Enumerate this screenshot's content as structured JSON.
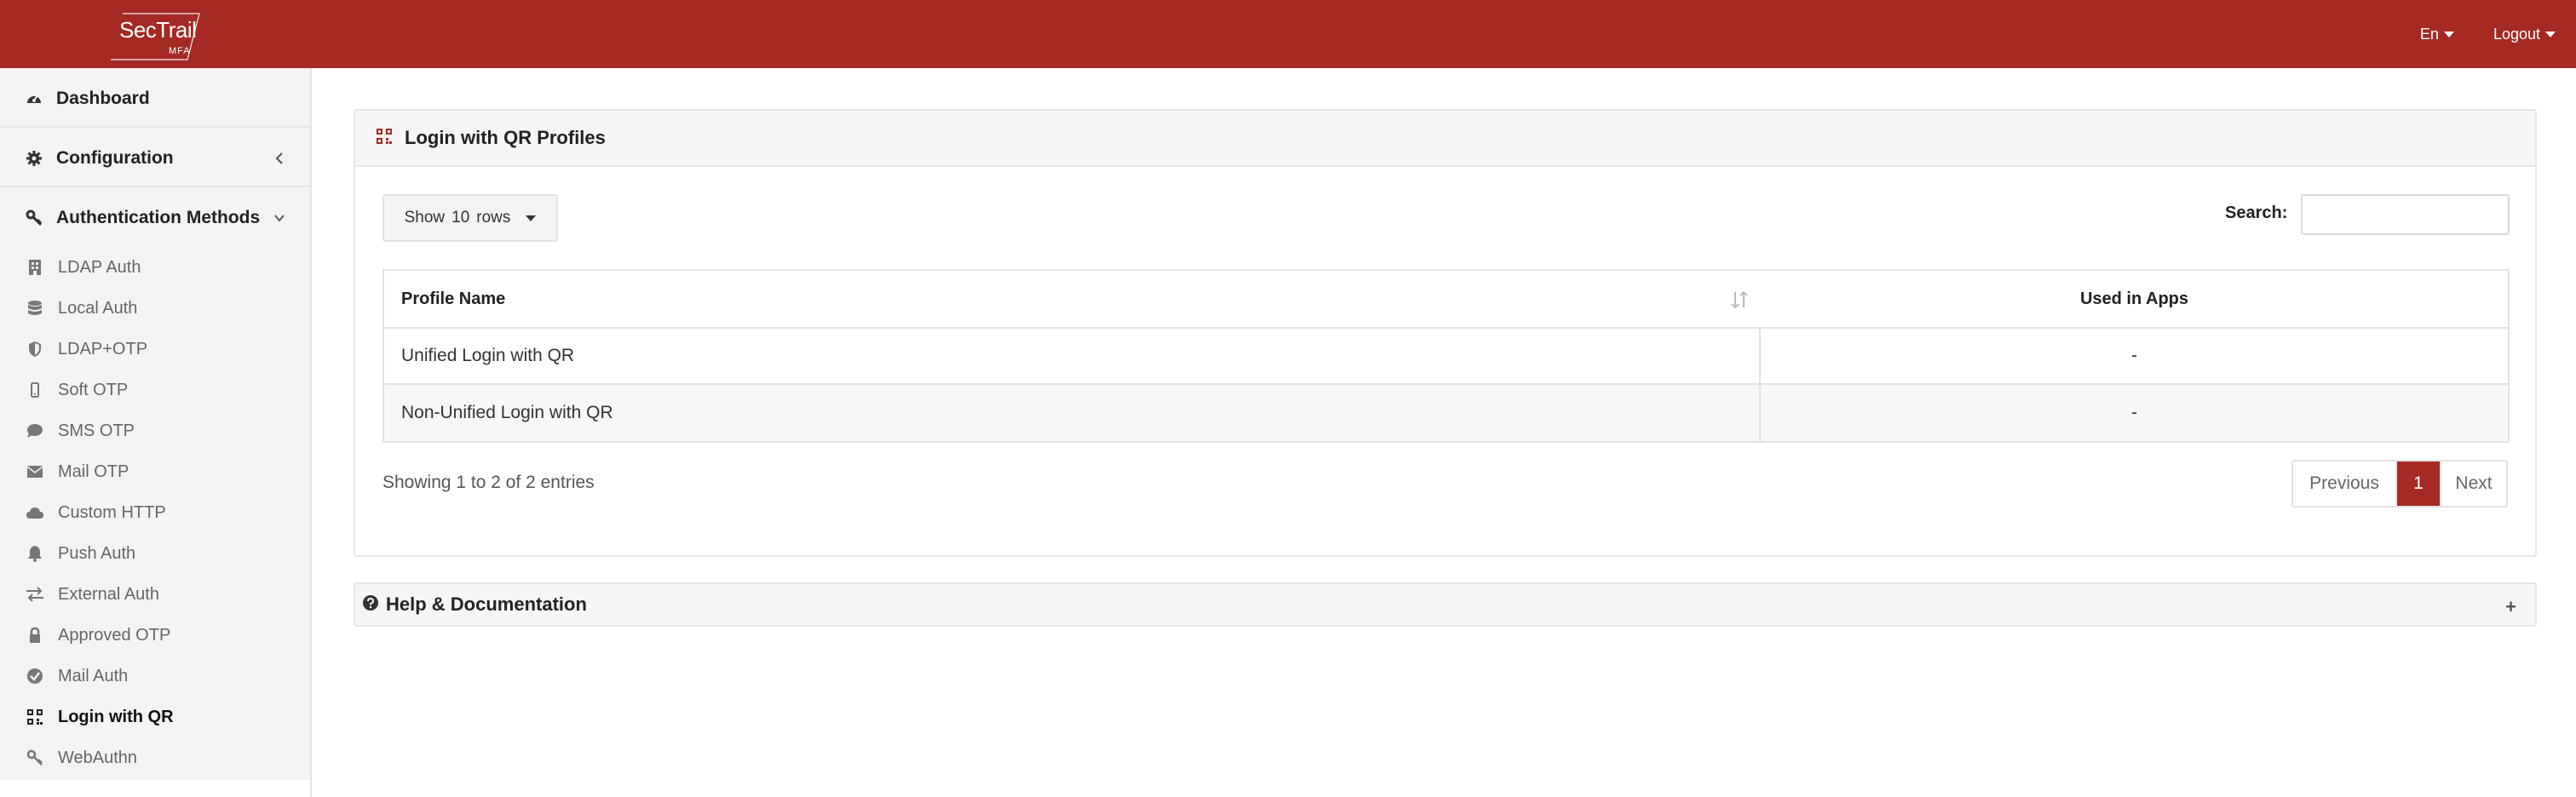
{
  "brand": {
    "name": "SecTrail",
    "registered": "®",
    "sub": "MFA"
  },
  "header": {
    "language": "En",
    "logout": "Logout"
  },
  "sidebar": {
    "top_items": [
      {
        "label": "Dashboard",
        "icon": "dashboard-icon"
      },
      {
        "label": "Configuration",
        "icon": "gear-icon"
      },
      {
        "label": "Authentication Methods",
        "icon": "key-icon"
      }
    ],
    "sub_items": [
      {
        "label": "LDAP Auth",
        "icon": "building-icon"
      },
      {
        "label": "Local Auth",
        "icon": "database-icon"
      },
      {
        "label": "LDAP+OTP",
        "icon": "shield-icon"
      },
      {
        "label": "Soft OTP",
        "icon": "mobile-icon"
      },
      {
        "label": "SMS OTP",
        "icon": "comment-icon"
      },
      {
        "label": "Mail OTP",
        "icon": "envelope-icon"
      },
      {
        "label": "Custom HTTP",
        "icon": "cloud-icon"
      },
      {
        "label": "Push Auth",
        "icon": "bell-icon"
      },
      {
        "label": "External Auth",
        "icon": "exchange-icon"
      },
      {
        "label": "Approved OTP",
        "icon": "lock-icon"
      },
      {
        "label": "Mail Auth",
        "icon": "check-circle-icon"
      },
      {
        "label": "Login with QR",
        "icon": "qrcode-icon",
        "active": true
      },
      {
        "label": "WebAuthn",
        "icon": "key-icon"
      }
    ]
  },
  "main": {
    "panel_title": "Login with QR Profiles",
    "show_rows": {
      "prefix": "Show",
      "value": "10",
      "suffix": "rows"
    },
    "search_label": "Search:",
    "search_value": "",
    "table": {
      "columns": [
        "Profile Name",
        "Used in Apps"
      ],
      "rows": [
        [
          "Unified Login with QR",
          "-"
        ],
        [
          "Non-Unified Login with QR",
          "-"
        ]
      ]
    },
    "info": "Showing 1 to 2 of 2 entries",
    "pagination": {
      "previous": "Previous",
      "current": "1",
      "next": "Next"
    }
  },
  "help": {
    "title": "Help & Documentation",
    "toggle": "+"
  },
  "colors": {
    "brand": "#a52a23",
    "panel_bg": "#f5f5f5",
    "sidebar_bg": "#f3f3f3"
  }
}
